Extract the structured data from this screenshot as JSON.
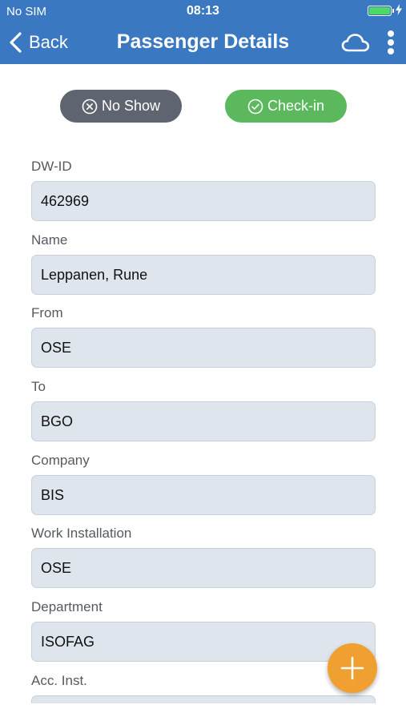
{
  "status_bar": {
    "carrier": "No SIM",
    "time": "08:13",
    "battery_color": "#4cd964"
  },
  "nav": {
    "back_label": "Back",
    "title": "Passenger Details"
  },
  "actions": {
    "no_show_label": "No Show",
    "check_in_label": "Check-in"
  },
  "colors": {
    "header": "#3a78c2",
    "no_show": "#5f6570",
    "check_in": "#5cb85c",
    "fab": "#f0a030"
  },
  "fields": [
    {
      "label": "DW-ID",
      "value": "462969"
    },
    {
      "label": "Name",
      "value": "Leppanen, Rune"
    },
    {
      "label": "From",
      "value": "OSE"
    },
    {
      "label": "To",
      "value": "BGO"
    },
    {
      "label": "Company",
      "value": "BIS"
    },
    {
      "label": "Work Installation",
      "value": "OSE"
    },
    {
      "label": "Department",
      "value": "ISOFAG"
    },
    {
      "label": "Acc. Inst.",
      "value": ""
    }
  ],
  "icons": {
    "back": "chevron-left-icon",
    "cloud": "cloud-icon",
    "more": "more-vertical-icon",
    "fab": "plus-icon"
  }
}
